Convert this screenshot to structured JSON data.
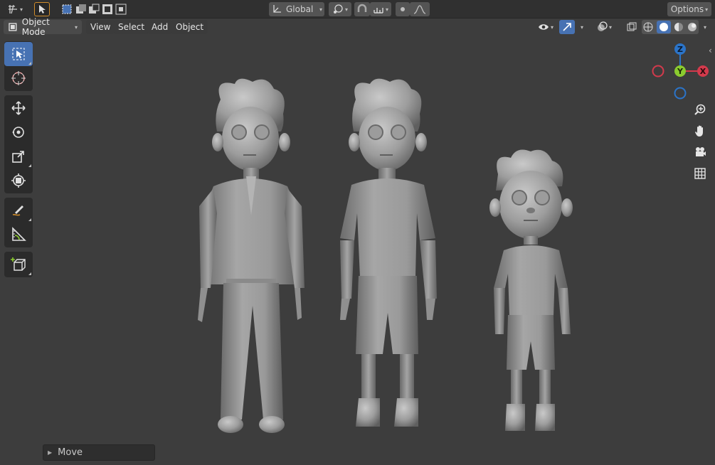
{
  "header": {
    "editor_type_icon": "view3d-icon",
    "select_modes": [
      "select-new-icon",
      "select-extend-icon",
      "select-subtract-icon",
      "select-invert-icon",
      "select-intersect-icon"
    ],
    "transform_orientation": "Global",
    "pivot_icon": "pivot-icon",
    "snap_icon": "snap-magnet-icon",
    "snap_target_icon": "snap-increment-icon",
    "proportional_icon": "proportional-edit-icon",
    "falloff_icon": "falloff-curve-icon",
    "options_label": "Options"
  },
  "subheader": {
    "mode_label": "Object Mode",
    "menus": [
      "View",
      "Select",
      "Add",
      "Object"
    ]
  },
  "tools": [
    {
      "name": "select-box-icon",
      "active": true
    },
    {
      "name": "cursor-icon",
      "active": false
    },
    {
      "name": "move-icon",
      "active": false
    },
    {
      "name": "rotate-icon",
      "active": false
    },
    {
      "name": "scale-icon",
      "active": false
    },
    {
      "name": "transform-icon",
      "active": false
    },
    {
      "name": "annotate-icon",
      "active": false
    },
    {
      "name": "measure-icon",
      "active": false
    },
    {
      "name": "add-cube-icon",
      "active": false
    }
  ],
  "gizmo": {
    "x_label": "X",
    "y_label": "Y",
    "z_label": "Z"
  },
  "colors": {
    "x_axis": "#d33a4c",
    "y_axis": "#8bcb2f",
    "z_axis": "#2b74c9",
    "active": "#4772b3"
  },
  "last_operator": {
    "label": "Move"
  }
}
